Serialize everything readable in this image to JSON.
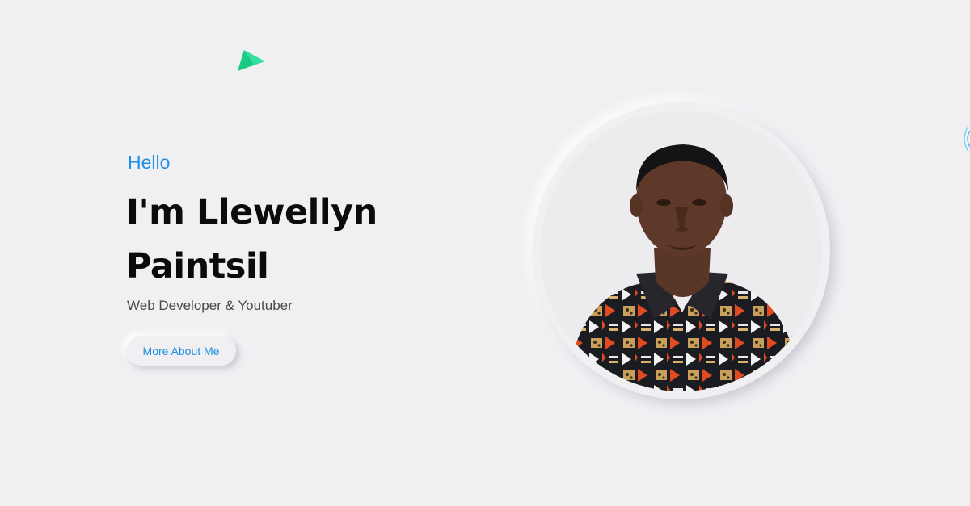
{
  "hero": {
    "greeting": "Hello",
    "name_line1": "I'm Llewellyn",
    "name_line2": "Paintsil",
    "subtitle": "Web Developer & Youtuber",
    "cta_label": "More About Me"
  },
  "portrait": {
    "alt": "Llewellyn Paintsil"
  },
  "colors": {
    "background": "#f0f0f3",
    "accent": "#1e90e6",
    "heading": "#0b0b0b",
    "decoration": "#1fd18b"
  },
  "icons": {
    "decoration_top": "triangle-decoration-icon",
    "decoration_right": "ring-decoration-icon"
  }
}
